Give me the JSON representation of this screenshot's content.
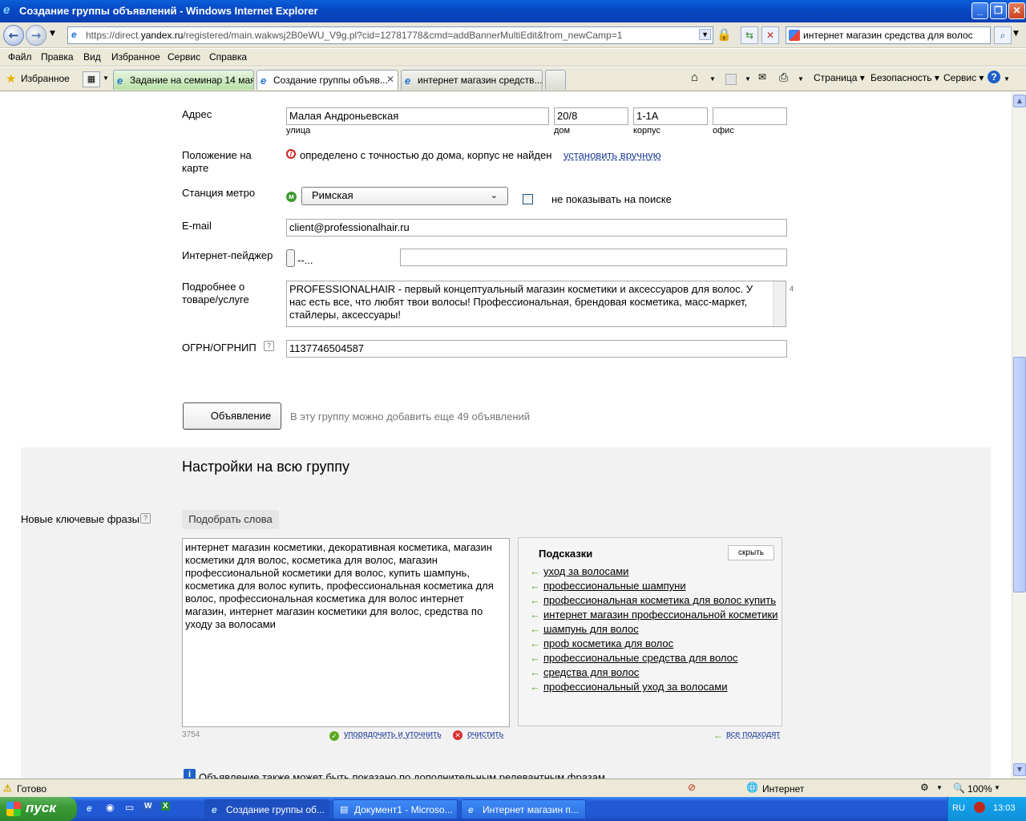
{
  "window": {
    "title": "Создание группы объявлений - Windows Internet Explorer"
  },
  "address_bar": {
    "url_prefix": "https://direct.",
    "url_domain": "yandex.ru",
    "url_path": "/registered/main.wakwsj2B0eWU_V9g.pl?cid=12781778&cmd=addBannerMultiEdit&from_newCamp=1"
  },
  "search_box": {
    "value": "интернет магазин средства для волос"
  },
  "menu": {
    "items": [
      "Файл",
      "Правка",
      "Вид",
      "Избранное",
      "Сервис",
      "Справка"
    ]
  },
  "favorites": {
    "label": "Избранное"
  },
  "tabs": [
    {
      "label": "Задание на семинар 14 мая..."
    },
    {
      "label": "Создание группы объяв..."
    },
    {
      "label": "интернет магазин средств..."
    }
  ],
  "toolbar": {
    "page": "Страница",
    "security": "Безопасность",
    "service": "Сервис"
  },
  "form": {
    "address": {
      "label": "Адрес",
      "street": "Малая Андроньевская",
      "street_sub": "улица",
      "house": "20/8",
      "house_sub": "дом",
      "building": "1-1А",
      "building_sub": "корпус",
      "office": "",
      "office_sub": "офис"
    },
    "map_position": {
      "label": "Положение на карте",
      "status": "определено с точностью до дома, корпус не найден",
      "set_manually": "установить вручную"
    },
    "metro": {
      "label": "Станция метро",
      "value": "Римская",
      "hide_label": "не показывать на поиске"
    },
    "email": {
      "label": "E-mail",
      "value": "client@professionalhair.ru"
    },
    "pager": {
      "label": "Интернет-пейджер",
      "type_value": "--...",
      "value": ""
    },
    "details": {
      "label": "Подробнее о товаре/услуге",
      "value": "PROFESSIONALHAIR - первый концептуальный магазин косметики и аксессуаров для волос. У нас есть все, что любят твои волосы! Профессиональная, брендовая косметика, масс-маркет, стайлеры, аксессуары!",
      "counter": "4"
    },
    "ogrn": {
      "label": "ОГРН/ОГРНИП",
      "value": "1137746504587"
    },
    "add_ad_button": "Объявление",
    "add_ad_note": "В эту группу можно добавить еще 49 объявлений"
  },
  "group_settings": {
    "title": "Настройки на всю группу",
    "keywords_label": "Новые ключевые фразы",
    "pick_words": "Подобрать слова",
    "keywords_text": "интернет магазин косметики, декоративная косметика, магазин косметики для волос, косметика для волос, магазин профессиональной косметики для волос, купить шампунь, косметика для волос купить, профессиональная косметика для волос, профессиональная косметика для волос интернет магазин, интернет магазин косметики для волос, средства по уходу за волосами",
    "char_count": "3754",
    "sort_refine": "упорядочить и уточнить",
    "clear": "очистить",
    "hints_title": "Подсказки",
    "hide": "скрыть",
    "hints": [
      "уход за волосами",
      "профессиональные шампуни",
      "профессиональная косметика для волос купить",
      "интернет магазин профессиональной косметики",
      "шампунь для волос",
      "проф косметика для волос",
      "профессиональные средства для волос",
      "средства для волос",
      "профессиональный уход за волосами"
    ],
    "all_fit": "все подходят",
    "cut_text": "Объявление также может быть показано по дополнительным релевантным фразам"
  },
  "status_bar": {
    "text": "Готово",
    "zone": "Интернет",
    "zoom": "100%"
  },
  "taskbar": {
    "start": "пуск",
    "tasks": [
      "Создание группы об...",
      "Документ1 - Microso...",
      "Интернет магазин п..."
    ],
    "lang": "RU",
    "clock": "13:03"
  }
}
